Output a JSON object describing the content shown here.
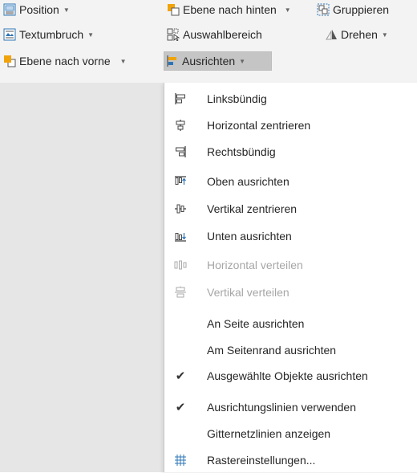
{
  "ribbon": {
    "row1": [
      {
        "label": "Position",
        "icon": "position-icon",
        "has_dropdown": true
      },
      {
        "label": "Ebene nach hinten",
        "icon": "send-backward-icon",
        "has_dropdown": true
      },
      {
        "label": "Gruppieren",
        "icon": "group-icon",
        "has_dropdown": false
      }
    ],
    "row2": [
      {
        "label": "Textumbruch",
        "icon": "wrap-text-icon",
        "has_dropdown": true
      },
      {
        "label": "Auswahlbereich",
        "icon": "selection-pane-icon",
        "has_dropdown": false
      },
      {
        "label": "Drehen",
        "icon": "rotate-icon",
        "has_dropdown": true
      }
    ],
    "row3": [
      {
        "label": "Ebene nach vorne",
        "icon": "bring-forward-icon",
        "has_dropdown": true
      },
      {
        "label": "Ausrichten",
        "icon": "align-icon",
        "has_dropdown": true,
        "pressed": true
      }
    ]
  },
  "align_menu": {
    "items": [
      {
        "label": "Linksbündig",
        "icon": "align-left-icon",
        "enabled": true
      },
      {
        "label": "Horizontal zentrieren",
        "icon": "align-center-icon",
        "enabled": true
      },
      {
        "label": "Rechtsbündig",
        "icon": "align-right-icon",
        "enabled": true
      },
      {
        "label": "Oben ausrichten",
        "icon": "align-top-icon",
        "enabled": true
      },
      {
        "label": "Vertikal zentrieren",
        "icon": "align-middle-icon",
        "enabled": true
      },
      {
        "label": "Unten ausrichten",
        "icon": "align-bottom-icon",
        "enabled": true
      },
      {
        "label": "Horizontal verteilen",
        "icon": "distribute-horizontal-icon",
        "enabled": false
      },
      {
        "label": "Vertikal verteilen",
        "icon": "distribute-vertical-icon",
        "enabled": false
      },
      {
        "label": "An Seite ausrichten",
        "icon": "",
        "enabled": true
      },
      {
        "label": "Am Seitenrand ausrichten",
        "icon": "",
        "enabled": true
      },
      {
        "label": "Ausgewählte Objekte ausrichten",
        "icon": "checkmark-icon",
        "enabled": true,
        "checked": true
      },
      {
        "label": "Ausrichtungslinien verwenden",
        "icon": "checkmark-icon",
        "enabled": true,
        "checked": true
      },
      {
        "label": "Gitternetzlinien anzeigen",
        "icon": "",
        "enabled": true
      },
      {
        "label": "Rastereinstellungen...",
        "icon": "grid-settings-icon",
        "enabled": true
      }
    ]
  },
  "colors": {
    "ribbon_bg": "#f3f3f3",
    "canvas_bg": "#e6e6e6",
    "pressed_bg": "#c5c5c5",
    "icon_blue": "#2e75b6",
    "icon_orange": "#f0a30a",
    "disabled_text": "#a6a6a6"
  }
}
